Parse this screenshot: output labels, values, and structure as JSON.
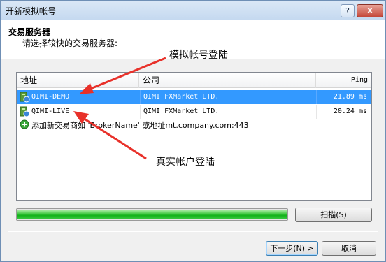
{
  "window": {
    "title": "开新模拟帐号",
    "help_label": "?",
    "close_label": "X"
  },
  "header": {
    "title": "交易服务器",
    "subtitle": "请选择较快的交易服务器:"
  },
  "list": {
    "columns": [
      "地址",
      "公司",
      "Ping"
    ],
    "rows": [
      {
        "name": "QIMI-DEMO",
        "company": "QIMI FXMarket LTD.",
        "ping": "21.89 ms",
        "selected": true
      },
      {
        "name": "QIMI-LIVE",
        "company": "QIMI FXMarket LTD.",
        "ping": "20.24 ms",
        "selected": false
      }
    ],
    "add_text": "添加新交易商如 'BrokerName' 或地址mt.company.com:443"
  },
  "progress": {
    "value": 1.0
  },
  "buttons": {
    "scan": "扫描(S)",
    "next": "下一步(N) >",
    "cancel": "取消"
  },
  "annotations": {
    "demo": "模拟帐号登陆",
    "live": "真实帐户登陆"
  },
  "colors": {
    "selection": "#3399ff",
    "progress": "#11b21a",
    "arrow": "#e8312a"
  }
}
